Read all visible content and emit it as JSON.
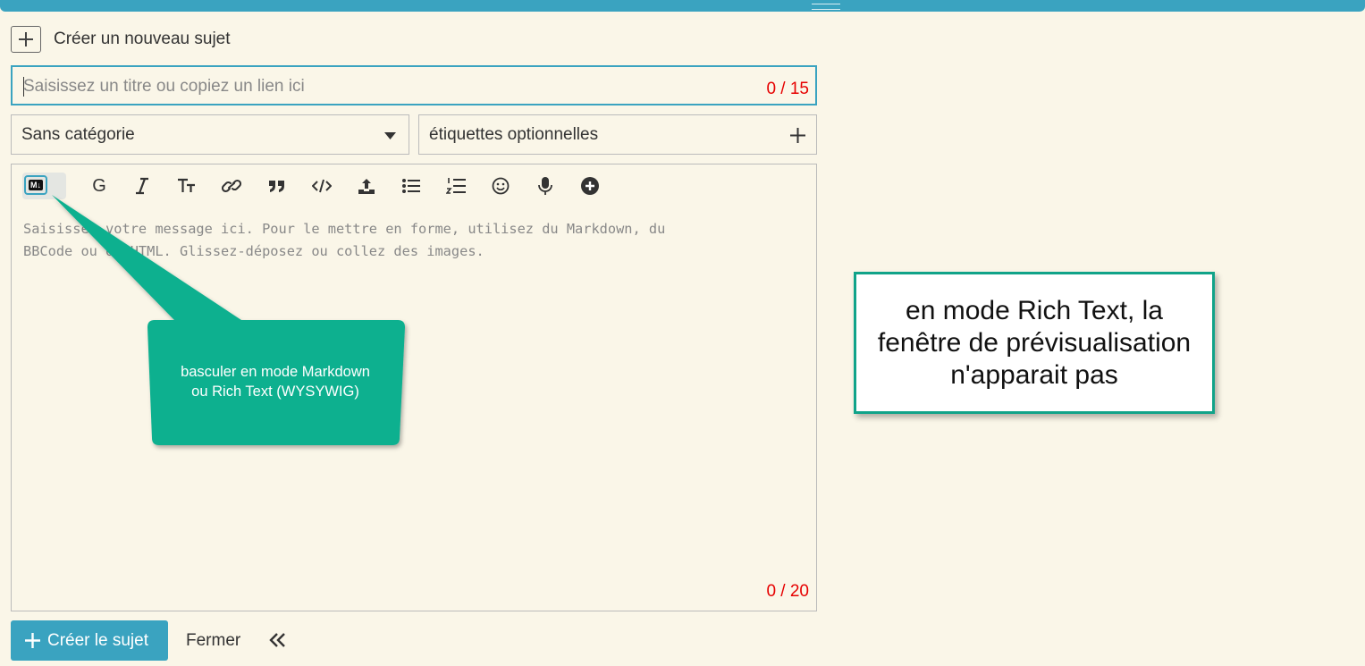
{
  "header": {
    "title": "Créer un nouveau sujet"
  },
  "title_field": {
    "placeholder": "Saisissez un titre ou copiez un lien ici",
    "counter": "0 / 15"
  },
  "category": {
    "value": "Sans catégorie"
  },
  "tags": {
    "placeholder": "étiquettes optionnelles"
  },
  "toolbar": {
    "toggle_label": "M↓",
    "bold_label": "G",
    "items": [
      "markdown-toggle",
      "bold",
      "italic",
      "heading",
      "link",
      "quote",
      "code",
      "upload",
      "bullet-list",
      "ordered-list",
      "emoji",
      "voice",
      "more-options"
    ]
  },
  "editor": {
    "placeholder_line1": "Saisissez votre message ici. Pour le mettre en forme, utilisez du Markdown, du",
    "placeholder_line2": "BBCode ou du HTML. Glissez-déposez ou collez des images.",
    "counter": "0 / 20"
  },
  "actions": {
    "create_label": "Créer le sujet",
    "close_label": "Fermer"
  },
  "callout": {
    "line1": "basculer en mode Markdown",
    "line2": "ou Rich Text (WYSYWIG)"
  },
  "note": {
    "line1": "en mode Rich Text, la",
    "line2": "fenêtre de prévisualisation",
    "line3": "n'apparait pas"
  },
  "colors": {
    "accent": "#3aa3c0",
    "counter": "#e60000",
    "callout": "#0db08f",
    "background": "#faf6e8"
  }
}
